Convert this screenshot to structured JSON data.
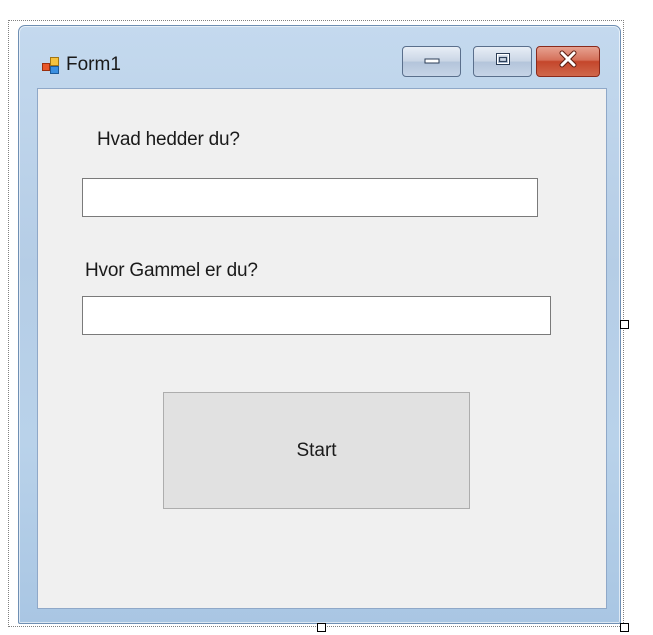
{
  "window": {
    "title": "Form1",
    "icon": "form-icon"
  },
  "caption_buttons": {
    "minimize_icon": "minimize-icon",
    "maximize_icon": "maximize-icon",
    "close_icon": "close-icon"
  },
  "form": {
    "name_label": "Hvad hedder du?",
    "name_value": "",
    "age_label": "Hvor Gammel er du?",
    "age_value": "",
    "start_label": "Start"
  },
  "colors": {
    "client_background": "#f0f0f0",
    "button_background": "#e1e1e1",
    "close_button": "#c4462b"
  }
}
